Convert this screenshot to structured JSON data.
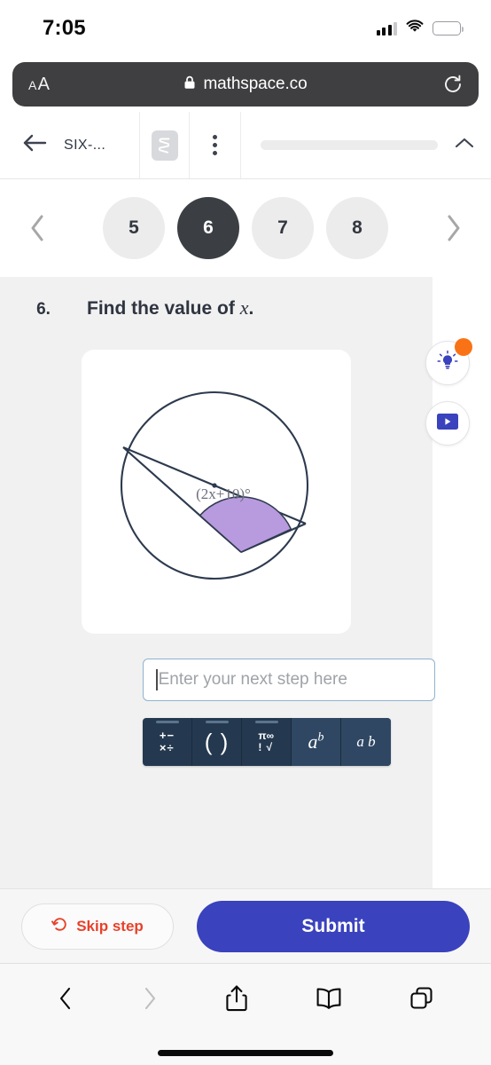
{
  "status_bar": {
    "time": "7:05",
    "cellular_icon": "signal-bars-icon",
    "wifi_icon": "wifi-icon",
    "battery_icon": "battery-icon",
    "battery_color": "#fcc419"
  },
  "browser": {
    "text_size_small": "A",
    "text_size_big": "A",
    "lock_icon": "lock-icon",
    "url": "mathspace.co",
    "reload_icon": "reload-icon",
    "bottom_toolbar": {
      "back_icon": "chevron-left-icon",
      "forward_icon": "chevron-right-icon",
      "share_icon": "share-icon",
      "bookmarks_icon": "book-icon",
      "tabs_icon": "tabs-icon"
    }
  },
  "app_nav": {
    "back_icon": "arrow-left-icon",
    "title": "SIX-...",
    "logo_icon": "mathspace-logo-icon",
    "menu_icon": "more-vertical-icon",
    "progress_percent": 0,
    "collapse_icon": "chevron-up-icon"
  },
  "pager": {
    "prev_icon": "chevron-left-icon",
    "next_icon": "chevron-right-icon",
    "items": [
      {
        "label": "5",
        "active": false
      },
      {
        "label": "6",
        "active": true
      },
      {
        "label": "7",
        "active": false
      },
      {
        "label": "8",
        "active": false
      }
    ]
  },
  "question": {
    "number": "6.",
    "prompt_prefix": "Find the value of ",
    "prompt_variable": "x",
    "prompt_suffix": ".",
    "diagram": {
      "type": "circle-geometry",
      "angle_label": "(2x+10)°",
      "angle_fill_color": "#b89ade",
      "stroke_color": "#2d3a4e",
      "label_color": "#6b6f7a"
    }
  },
  "answer": {
    "placeholder": "Enter your next step here",
    "value": ""
  },
  "math_keypad": {
    "keys": [
      {
        "name": "operators-key",
        "selected": false,
        "glyphs": [
          "+",
          "−",
          "×",
          "÷"
        ]
      },
      {
        "name": "parentheses-key",
        "selected": false,
        "label": "( )"
      },
      {
        "name": "functions-key",
        "selected": false,
        "glyphs": [
          "π",
          "∞",
          "!",
          "√"
        ]
      },
      {
        "name": "exponent-key",
        "selected": true,
        "base": "a",
        "exponent": "b"
      },
      {
        "name": "fraction-key",
        "selected": true,
        "numerator": "a",
        "denominator": "b"
      }
    ]
  },
  "helpers": {
    "hint_icon": "lightbulb-icon",
    "hint_badge": true,
    "video_icon": "play-video-icon"
  },
  "actions": {
    "skip_icon": "skip-step-icon",
    "skip_label": "Skip step",
    "skip_color": "#e8412a",
    "submit_label": "Submit",
    "submit_color": "#3a42bd"
  }
}
